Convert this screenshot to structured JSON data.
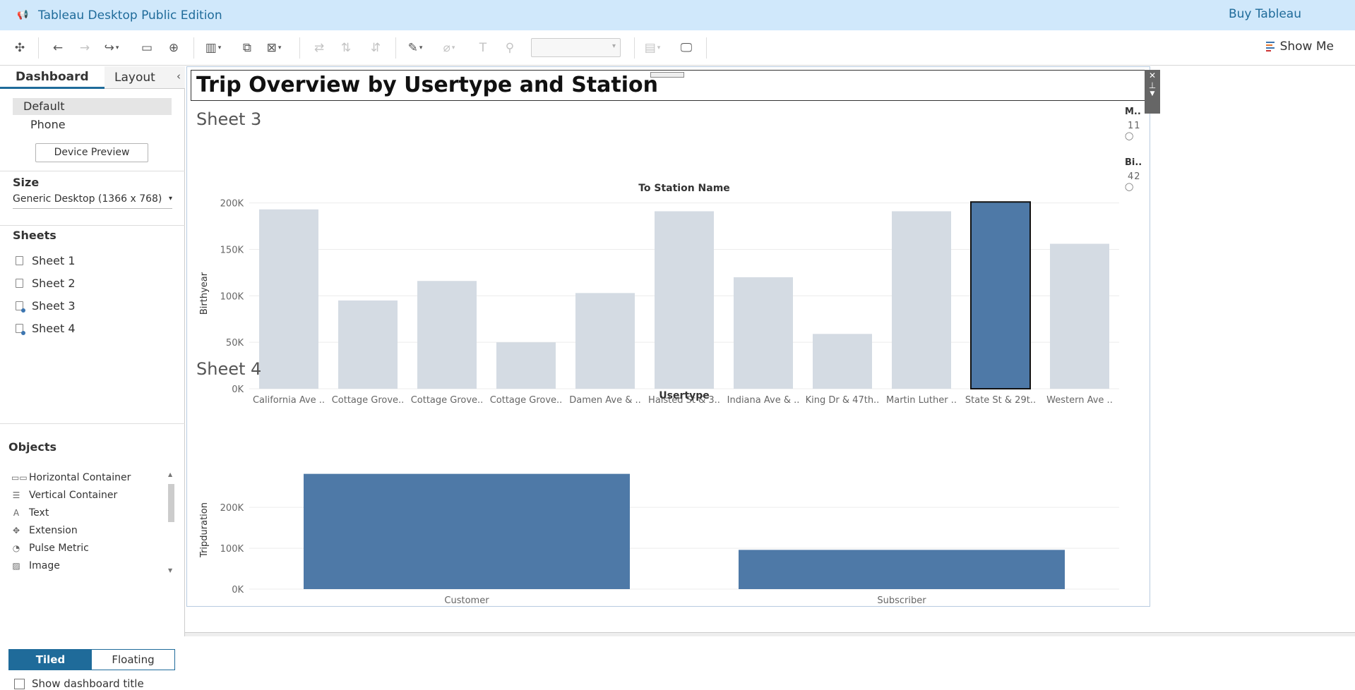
{
  "app": {
    "title": "Tableau Desktop Public Edition",
    "buy_label": "Buy Tableau",
    "show_me": "Show Me"
  },
  "left_panel": {
    "tabs": [
      "Dashboard",
      "Layout"
    ],
    "device_options": [
      "Default",
      "Phone"
    ],
    "device_preview": "Device Preview",
    "size_heading": "Size",
    "size_value": "Generic Desktop (1366 x 768)",
    "sheets_heading": "Sheets",
    "sheets": [
      "Sheet 1",
      "Sheet 2",
      "Sheet 3",
      "Sheet 4"
    ],
    "objects_heading": "Objects",
    "objects": [
      "Horizontal Container",
      "Vertical Container",
      "Text",
      "Extension",
      "Pulse Metric",
      "Image"
    ],
    "layout_modes": [
      "Tiled",
      "Floating"
    ],
    "show_title_label": "Show dashboard title"
  },
  "dashboard": {
    "title": "Trip Overview by Usertype and Station",
    "legends": [
      {
        "title": "M..",
        "value": "11"
      },
      {
        "title": "Bi..",
        "value": "42"
      }
    ]
  },
  "chart_data": [
    {
      "type": "bar",
      "sheet_title": "Sheet 3",
      "title": "To Station Name",
      "ylabel": "Birthyear",
      "yticks": [
        "0K",
        "50K",
        "100K",
        "150K",
        "200K"
      ],
      "ylim": [
        0,
        205000
      ],
      "categories": [
        "California Ave ..",
        "Cottage Grove..",
        "Cottage Grove..",
        "Cottage Grove..",
        "Damen Ave & ..",
        "Halsted St & 3..",
        "Indiana Ave & ..",
        "King Dr & 47th..",
        "Martin Luther ..",
        "State St & 29t..",
        "Western Ave .."
      ],
      "values": [
        193000,
        95000,
        116000,
        50000,
        103000,
        191000,
        120000,
        59000,
        191000,
        201000,
        156000
      ],
      "highlighted": "State St & 29t..",
      "colors": {
        "bar": "#d4dbe3",
        "highlight": "#4e79a7"
      }
    },
    {
      "type": "bar",
      "sheet_title": "Sheet 4",
      "title": "Usertype",
      "ylabel": "Tripduration",
      "yticks": [
        "0K",
        "100K",
        "200K"
      ],
      "ylim": [
        0,
        290000
      ],
      "categories": [
        "Customer",
        "Subscriber"
      ],
      "values": [
        282000,
        96000
      ],
      "colors": {
        "bar": "#4e79a7"
      }
    }
  ]
}
